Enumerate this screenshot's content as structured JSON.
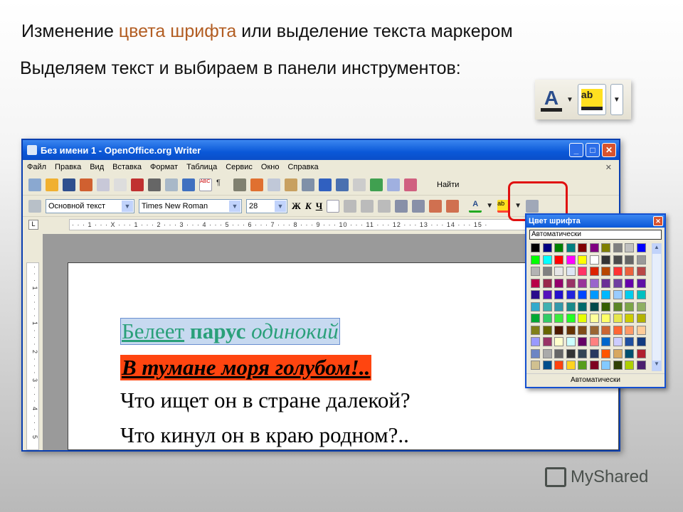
{
  "heading": {
    "part1": "Изменение ",
    "accent": "цвета шрифта",
    "part2": " или выделение текста маркером",
    "accent_color": "#b25d22"
  },
  "subheading": "Выделяем текст и выбираем в панели инструментов:",
  "window": {
    "title": "Без имени 1 - OpenOffice.org Writer",
    "menu": [
      "Файл",
      "Правка",
      "Вид",
      "Вставка",
      "Формат",
      "Таблица",
      "Сервис",
      "Окно",
      "Справка"
    ],
    "find_label": "Найти",
    "style_value": "Основной текст",
    "font_value": "Times New Roman",
    "size_value": "28",
    "bold_label": "Ж",
    "italic_label": "К",
    "underline_label": "Ч",
    "ruler_h": "· · · 1 · · · X · · · 1 · · · 2 · · · 3 · · · 4 · · · 5 · · · 6 · · · 7 · · · 8 · · · 9 · · · 10 · · · 11 · · · 12 · · · 13 · · · 14 · · · 15 ·",
    "ruler_v": "· · · 1 · · · · 1 · · · 2 · · · 3 · · · 4 · · · 5"
  },
  "document": {
    "line1": {
      "w1": "Белеет",
      "w2": " парус",
      "w3": " одинокий",
      "color": "#2aa07a"
    },
    "line2": "В тумане моря голубом!..",
    "line2_highlight": "#ff4510",
    "line3": "Что ищет он в стране далекой?",
    "line4": "Что кинул он в краю родном?.."
  },
  "color_popup": {
    "title": "Цвет шрифта",
    "top_option": "Автоматически",
    "bottom_option": "Автоматически",
    "palette": [
      "#000000",
      "#000080",
      "#008000",
      "#008080",
      "#800000",
      "#800080",
      "#808000",
      "#808080",
      "#c0c0c0",
      "#0000ff",
      "#00ff00",
      "#00ffff",
      "#ff0000",
      "#ff00ff",
      "#ffff00",
      "#ffffff",
      "#333333",
      "#4c4c4c",
      "#666666",
      "#999999",
      "#b3b3b3",
      "#808080",
      "#e6e6e6",
      "#dde6f5",
      "#ff3366",
      "#dc2300",
      "#b84700",
      "#ff3333",
      "#eb613d",
      "#b84747",
      "#b80047",
      "#99284c",
      "#94006b",
      "#993366",
      "#993399",
      "#9966cc",
      "#6b2e96",
      "#7040a0",
      "#6600aa",
      "#5e11a6",
      "#2a0a8c",
      "#5511bb",
      "#2310cc",
      "#2323dc",
      "#0047ff",
      "#0099ff",
      "#00b8ff",
      "#99ccff",
      "#00ccee",
      "#00c0c0",
      "#33aacc",
      "#40b0b0",
      "#3399aa",
      "#198a8a",
      "#006b6b",
      "#004a4a",
      "#355e00",
      "#5c8526",
      "#7da647",
      "#8fb062",
      "#00a933",
      "#33cc66",
      "#3deb3d",
      "#23ff23",
      "#e6ff00",
      "#ffff99",
      "#ffff66",
      "#e6e64c",
      "#cccc00",
      "#b3b300",
      "#808019",
      "#666600",
      "#4c1900",
      "#663300",
      "#804c19",
      "#996633",
      "#cc6633",
      "#ff6633",
      "#ff9966",
      "#ffcc99",
      "#9999ff",
      "#993366",
      "#ffffcc",
      "#ccffff",
      "#660066",
      "#ff8080",
      "#0066cc",
      "#ccccff",
      "#1f4fa0",
      "#123a80",
      "#6d86c4",
      "#aaaaaa",
      "#666666",
      "#333333",
      "#334455",
      "#283860",
      "#ff5500",
      "#d8a860",
      "#005070",
      "#b02030",
      "#d0c090",
      "#004e8c",
      "#ff420e",
      "#ffd320",
      "#579d1c",
      "#7e0021",
      "#83caff",
      "#314004",
      "#aecf00",
      "#4b1f6f"
    ]
  },
  "logo": "MyShared"
}
